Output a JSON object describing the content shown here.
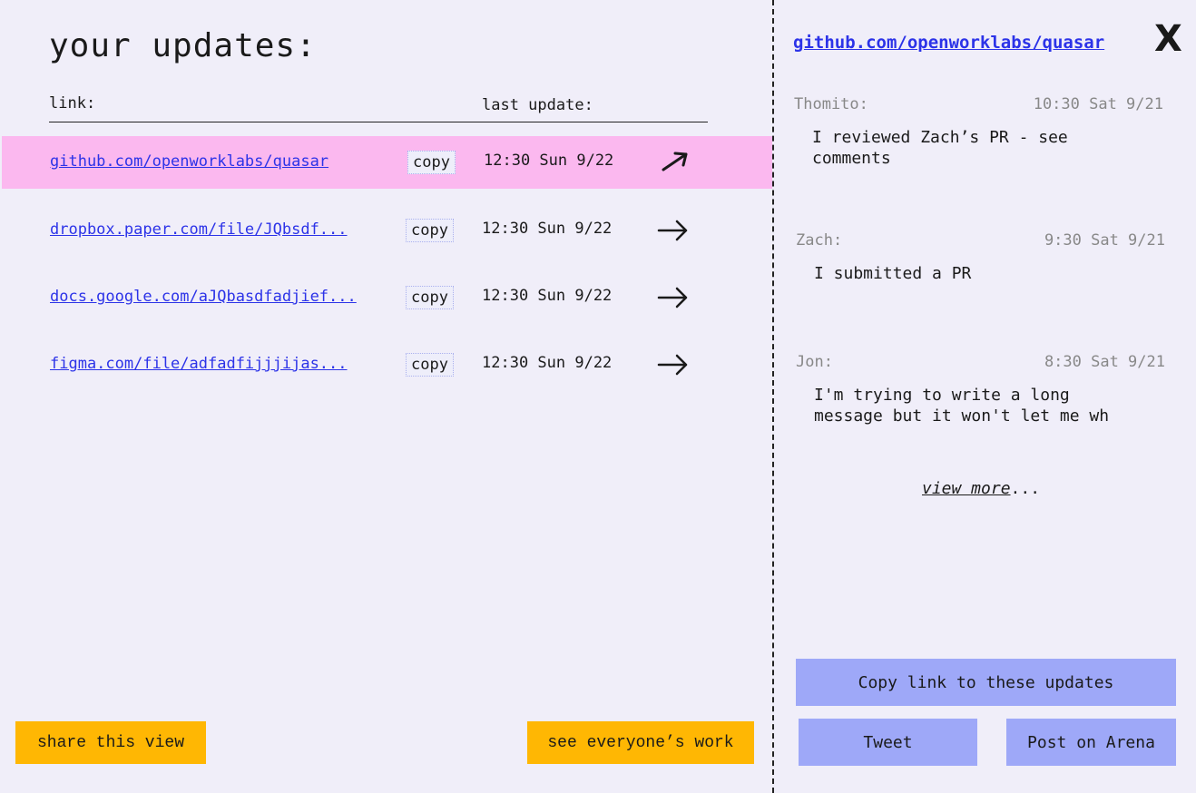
{
  "page": {
    "title": "your updates:",
    "columns": {
      "link": "link:",
      "last_update": "last update:"
    }
  },
  "updates": [
    {
      "link": "github.com/openworklabs/quasar",
      "copy": "copy",
      "date": "12:30 Sun 9/22",
      "icon": "arrow-up-right-icon",
      "active": true
    },
    {
      "link": "dropbox.paper.com/file/JQbsdf...",
      "copy": "copy",
      "date": "12:30 Sun 9/22",
      "icon": "arrow-right-icon",
      "active": false
    },
    {
      "link": "docs.google.com/aJQbasdfadjief...",
      "copy": "copy",
      "date": "12:30 Sun 9/22",
      "icon": "arrow-right-icon",
      "active": false
    },
    {
      "link": "figma.com/file/adfadfijjjijas...",
      "copy": "copy",
      "date": "12:30 Sun 9/22",
      "icon": "arrow-right-icon",
      "active": false
    }
  ],
  "footer": {
    "share_label": "share this view",
    "everyone_label": "see everyone’s work"
  },
  "colors": {
    "background": "#f0eef9",
    "active_row": "#fbb8ef",
    "link": "#2c33e8",
    "primary_button": "#ffb703",
    "secondary_button": "#9ea8f8"
  },
  "sidebar": {
    "repo_link": "github.com/openworklabs/quasar",
    "close_label": "X",
    "messages": [
      {
        "author": "Thomito:",
        "time": "10:30 Sat 9/21",
        "body": "I reviewed Zach’s PR - see comments"
      },
      {
        "author": "Zach:",
        "time": "9:30 Sat 9/21",
        "body": "I submitted a PR"
      },
      {
        "author": "Jon:",
        "time": "8:30 Sat 9/21",
        "body": "I'm trying to write a long message but it won't let me wh"
      }
    ],
    "view_more_label": "view more",
    "view_more_suffix": "...",
    "copy_link_label": "Copy link to these updates",
    "tweet_label": "Tweet",
    "arena_label": "Post on Arena"
  }
}
